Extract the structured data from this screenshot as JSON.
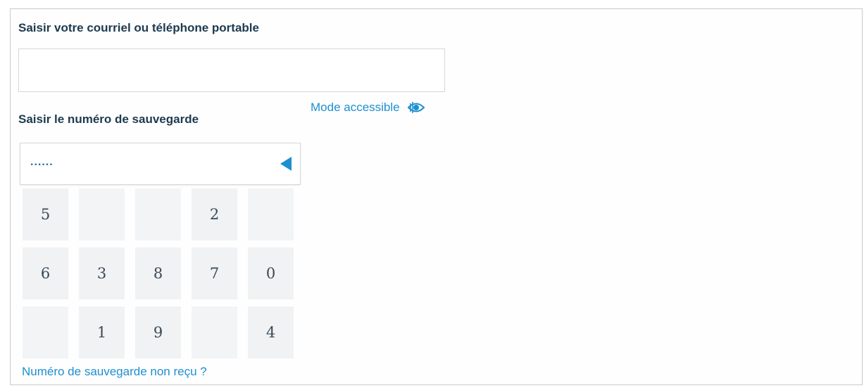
{
  "email": {
    "label": "Saisir votre courriel ou téléphone portable",
    "value": ""
  },
  "accessible": {
    "label": "Mode accessible",
    "icon": "eye-icon",
    "color": "#1e8fd0"
  },
  "code": {
    "label": "Saisir le numéro de sauvegarde",
    "masked_value": "......",
    "backspace_icon": "backspace-triangle-icon"
  },
  "keypad": {
    "keys": [
      "5",
      "",
      "",
      "2",
      "",
      "6",
      "3",
      "8",
      "7",
      "0",
      "",
      "1",
      "9",
      "",
      "4"
    ]
  },
  "footer": {
    "not_received_link": "Numéro de sauvegarde non reçu ?"
  }
}
